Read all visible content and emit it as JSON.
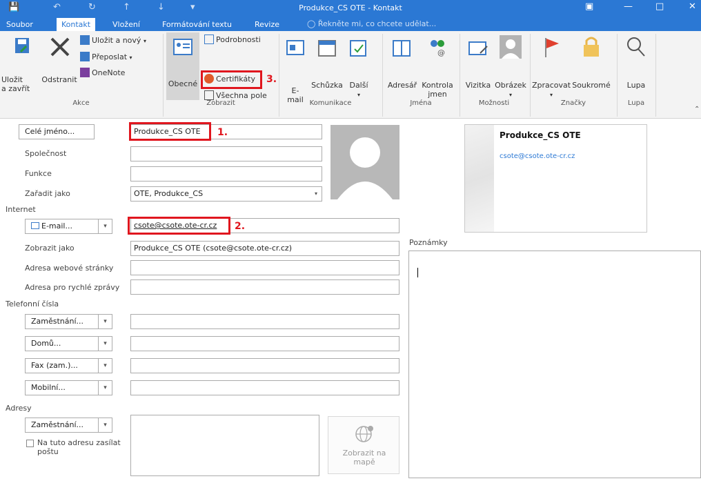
{
  "window": {
    "title": "Produkce_CS OTE - Kontakt"
  },
  "tabs": [
    {
      "label": "Soubor"
    },
    {
      "label": "Kontakt"
    },
    {
      "label": "Vložení"
    },
    {
      "label": "Formátování textu"
    },
    {
      "label": "Revize"
    }
  ],
  "tell_me": "Řekněte mi, co chcete udělat...",
  "ribbon": {
    "akce": {
      "group_label": "Akce",
      "save_close": "Uložit\na zavřít",
      "delete": "Odstranit",
      "save_new": "Uložit a nový",
      "forward": "Přeposlat",
      "onenote": "OneNote"
    },
    "zobrazit": {
      "group_label": "Zobrazit",
      "general": "Obecné",
      "details": "Podrobnosti",
      "certificates": "Certifikáty",
      "all_fields": "Všechna pole"
    },
    "komunikace": {
      "group_label": "Komunikace",
      "email": "E-\nmail",
      "meeting": "Schůzka",
      "more": "Další"
    },
    "jmena": {
      "group_label": "Jména",
      "address_book": "Adresář",
      "check_names": "Kontrola\njmen"
    },
    "moznosti": {
      "group_label": "Možnosti",
      "business_card": "Vizitka",
      "picture": "Obrázek"
    },
    "znacky": {
      "group_label": "Značky",
      "follow_up": "Zpracovat",
      "private": "Soukromé"
    },
    "lupa": {
      "group_label": "Lupa",
      "zoom": "Lupa"
    }
  },
  "form": {
    "full_name_button": "Celé jméno...",
    "full_name_value": "Produkce_CS OTE",
    "company_label": "Společnost",
    "job_title_label": "Funkce",
    "file_as_label": "Zařadit jako",
    "file_as_value": "OTE, Produkce_CS",
    "internet_section": "Internet",
    "email_button": "E-mail...",
    "email_value": "csote@csote.ote-cr.cz",
    "display_as_label": "Zobrazit jako",
    "display_as_value": "Produkce_CS OTE (csote@csote.ote-cr.cz)",
    "web_label": "Adresa webové stránky",
    "im_label": "Adresa pro rychlé zprávy",
    "phones_section": "Telefonní čísla",
    "phone1": "Zaměstnání...",
    "phone2": "Domů...",
    "phone3": "Fax (zam.)...",
    "phone4": "Mobilní...",
    "addresses_section": "Adresy",
    "address_button": "Zaměstnání...",
    "mailing_checkbox": "Na tuto adresu zasílat\npoštu",
    "map_button": "Zobrazit na\nmapě",
    "notes_label": "Poznámky"
  },
  "business_card": {
    "name": "Produkce_CS OTE",
    "email": "csote@csote.ote-cr.cz"
  },
  "annotations": {
    "n1": "1.",
    "n2": "2.",
    "n3": "3."
  },
  "colors": {
    "accent": "#2b78d4",
    "highlight": "#e0161e"
  }
}
